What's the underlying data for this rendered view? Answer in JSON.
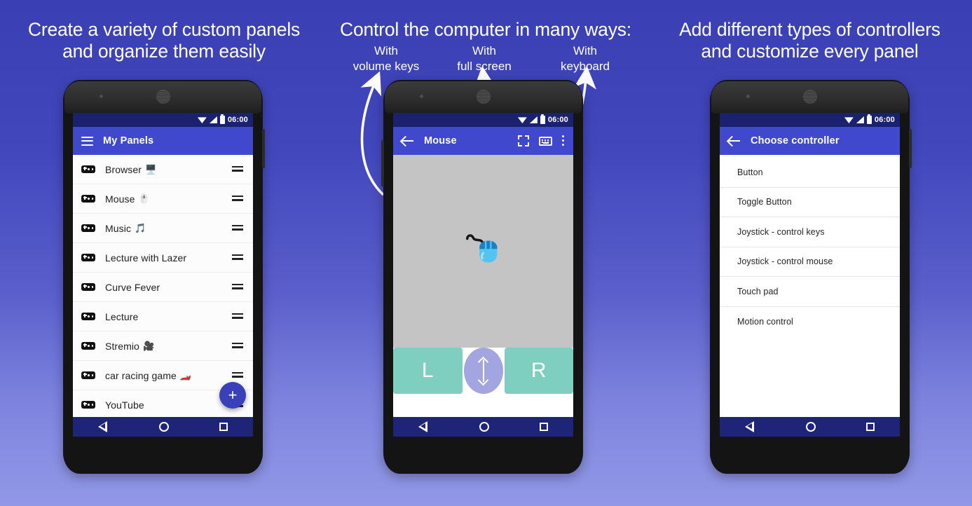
{
  "headings": {
    "left": "Create a variety of custom panels\nand organize them easily",
    "middle": "Control the computer in many ways:",
    "right": "Add different types of controllers\nand customize every panel"
  },
  "callouts": [
    {
      "id": "volume-keys",
      "text": "With\nvolume keys"
    },
    {
      "id": "full-screen",
      "text": "With\nfull screen"
    },
    {
      "id": "keyboard",
      "text": "With\nkeyboard"
    }
  ],
  "colors": {
    "background_top": "#3a3fb3",
    "background_bottom": "#9298e6",
    "appbar": "#4049ce",
    "statusbar": "#1a2270",
    "navbar": "#1e2478",
    "fab": "#3a40b8",
    "mouse_button": "#7ecfc0",
    "mouse_wheel": "#a3a5e0",
    "touch_area": "#c4c4c4"
  },
  "statusbar": {
    "time": "06:00",
    "icons": [
      "wifi-icon",
      "signal-icon",
      "battery-icon"
    ]
  },
  "navbar": {
    "back_label": "back-nav-button",
    "home_label": "home-nav-button",
    "recents_label": "recents-nav-button"
  },
  "phone_left": {
    "appbar": {
      "menu_icon": "hamburger-icon",
      "title": "My Panels"
    },
    "fab_label": "+",
    "panels": [
      {
        "name": "Browser",
        "emoji": "🖥️"
      },
      {
        "name": "Mouse",
        "emoji": "🖱️"
      },
      {
        "name": "Music",
        "emoji": "🎵"
      },
      {
        "name": "Lecture with Lazer",
        "emoji": ""
      },
      {
        "name": "Curve Fever",
        "emoji": ""
      },
      {
        "name": "Lecture",
        "emoji": ""
      },
      {
        "name": "Stremio",
        "emoji": "🎥"
      },
      {
        "name": "car racing game",
        "emoji": "🏎️"
      },
      {
        "name": "YouTube",
        "emoji": ""
      }
    ]
  },
  "phone_middle": {
    "appbar": {
      "back_icon": "back-arrow-icon",
      "title": "Mouse",
      "actions": [
        "fullscreen-icon",
        "keyboard-icon",
        "overflow-menu-icon"
      ]
    },
    "touchpad_graphic": "mouse-emoji",
    "buttons": {
      "left": "L",
      "right": "R",
      "wheel": "scroll-wheel"
    }
  },
  "phone_right": {
    "appbar": {
      "back_icon": "back-arrow-icon",
      "title": "Choose controller"
    },
    "controllers": [
      "Button",
      "Toggle Button",
      "Joystick - control keys",
      "Joystick - control mouse",
      "Touch pad",
      "Motion control"
    ]
  }
}
